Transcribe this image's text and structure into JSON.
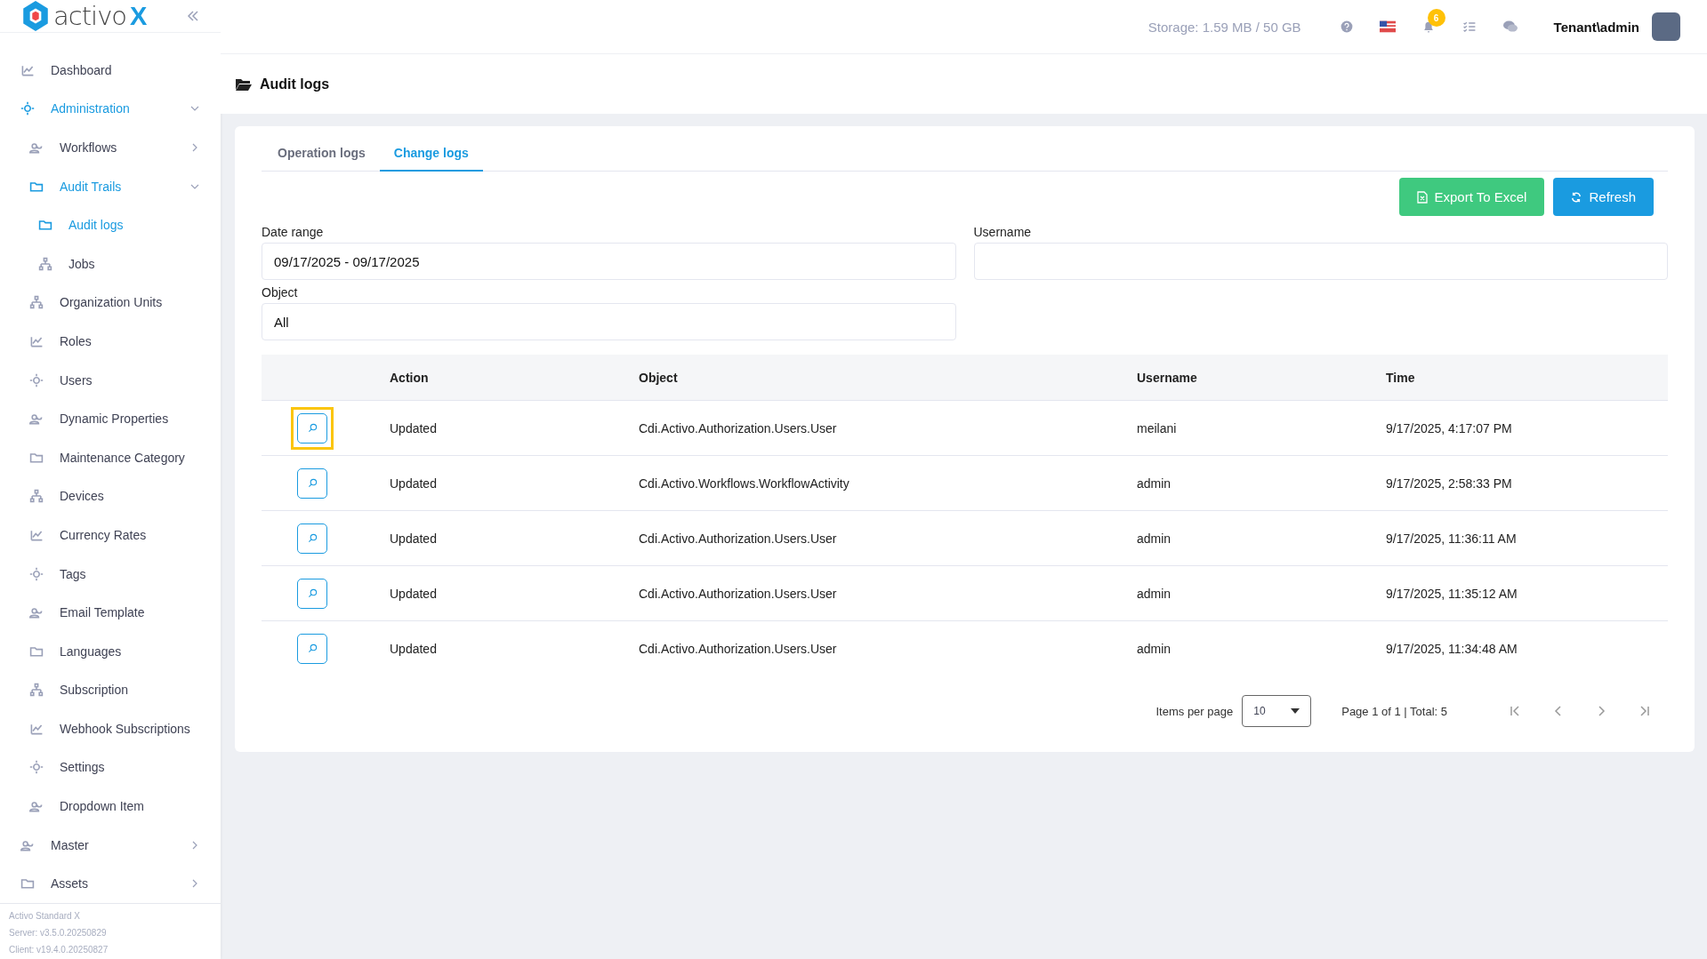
{
  "sidebar": {
    "logo": {
      "word": "activo",
      "mark": "X"
    },
    "items": [
      {
        "label": "Dashboard"
      },
      {
        "label": "Administration",
        "expanded": true,
        "children": [
          {
            "label": "Workflows",
            "expanded": false
          },
          {
            "label": "Audit Trails",
            "expanded": true,
            "children": [
              {
                "label": "Audit logs",
                "selected": true
              },
              {
                "label": "Jobs",
                "selected": false
              }
            ]
          },
          {
            "label": "Organization Units",
            "selected": false
          },
          {
            "label": "Roles",
            "selected": false
          },
          {
            "label": "Users",
            "selected": false
          },
          {
            "label": "Dynamic Properties",
            "selected": false
          },
          {
            "label": "Maintenance Category",
            "selected": false
          },
          {
            "label": "Devices",
            "selected": false
          },
          {
            "label": "Currency Rates",
            "selected": false
          },
          {
            "label": "Tags",
            "selected": false
          },
          {
            "label": "Email Template",
            "selected": false
          },
          {
            "label": "Languages",
            "selected": false
          },
          {
            "label": "Subscription",
            "selected": false
          },
          {
            "label": "Webhook Subscriptions",
            "selected": false
          },
          {
            "label": "Settings",
            "selected": false
          },
          {
            "label": "Dropdown Item",
            "selected": false
          }
        ]
      },
      {
        "label": "Master",
        "expanded": false
      },
      {
        "label": "Assets",
        "expanded": false
      }
    ],
    "footer": [
      "Activo Standard X",
      "Server: v3.5.0.20250829",
      "Client: v19.4.0.20250827"
    ]
  },
  "header": {
    "storage": "Storage: 1.59 MB / 50 GB",
    "notification_count": "6",
    "user": "Tenant\\admin"
  },
  "page_title": "Audit logs",
  "tabs": [
    {
      "label": "Operation logs",
      "selected": false
    },
    {
      "label": "Change logs",
      "selected": true
    }
  ],
  "buttons": {
    "export": "Export To Excel",
    "refresh": "Refresh"
  },
  "filters": {
    "date_range": {
      "label": "Date range",
      "value": "09/17/2025 - 09/17/2025"
    },
    "username": {
      "label": "Username"
    },
    "object": {
      "label": "Object",
      "value": "All"
    }
  },
  "table": {
    "columns": [
      "Action",
      "Object",
      "Username",
      "Time"
    ],
    "rows": [
      {
        "highlighted": true,
        "cells": [
          "Updated",
          "Cdi.Activo.Authorization.Users.User",
          "meilani",
          "9/17/2025, 4:17:07 PM"
        ]
      },
      {
        "highlighted": false,
        "cells": [
          "Updated",
          "Cdi.Activo.Workflows.WorkflowActivity",
          "admin",
          "9/17/2025, 2:58:33 PM"
        ]
      },
      {
        "highlighted": false,
        "cells": [
          "Updated",
          "Cdi.Activo.Authorization.Users.User",
          "admin",
          "9/17/2025, 11:36:11 AM"
        ]
      },
      {
        "highlighted": false,
        "cells": [
          "Updated",
          "Cdi.Activo.Authorization.Users.User",
          "admin",
          "9/17/2025, 11:35:12 AM"
        ]
      },
      {
        "highlighted": false,
        "cells": [
          "Updated",
          "Cdi.Activo.Authorization.Users.User",
          "admin",
          "9/17/2025, 11:34:48 AM"
        ]
      }
    ]
  },
  "pagination": {
    "items_per_page_label": "Items per page",
    "page_size": "10",
    "summary": "Page 1 of 1 | Total: 5"
  }
}
